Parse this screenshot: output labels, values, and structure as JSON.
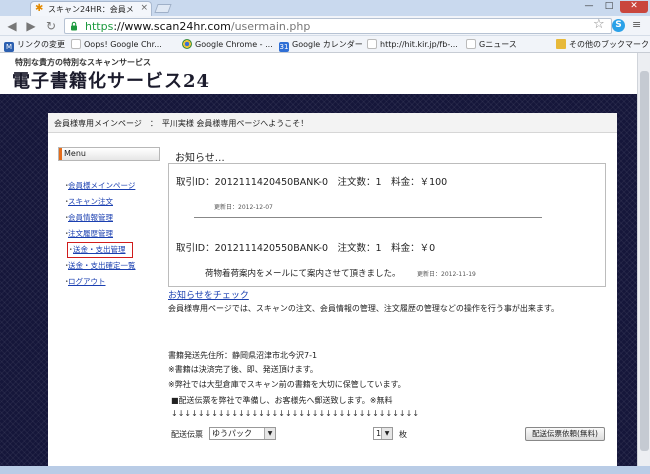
{
  "browser": {
    "tab_title": "スキャン24HR：会員メ",
    "url_secure": "https",
    "url_host": "://www.scan24hr.com",
    "url_path": "/usermain.php",
    "window_controls": {
      "minimize": "—",
      "maximize": "□",
      "close": "✕"
    },
    "bookmarks": [
      {
        "label": "リンクの変更",
        "icon": "m-icon",
        "color": "#2b5fb0"
      },
      {
        "label": "Oops! Google Chr...",
        "icon": "page-icon",
        "color": "#bbbbbb"
      },
      {
        "label": "Google Chrome - ...",
        "icon": "chrome-icon",
        "color": "#3b8e3f"
      },
      {
        "label": "Google カレンダー",
        "icon": "calendar-icon",
        "color": "#2f6fd6"
      },
      {
        "label": "http://hit.kir.jp/fb-...",
        "icon": "page-icon",
        "color": "#bbbbbb"
      },
      {
        "label": "Gニュース",
        "icon": "page-icon",
        "color": "#bbbbbb"
      }
    ],
    "other_bookmarks": "その他のブックマーク"
  },
  "site": {
    "tagline": "特別な貴方の特別なスキャンサービス",
    "logo": "電子書籍化サービス24"
  },
  "panel": {
    "breadcrumb": "会員様専用メインページ　：　平川実様 会員様専用ページへようこそ！",
    "menu": {
      "title": "Menu",
      "items": [
        "会員様メインページ",
        "スキャン注文",
        "会員情報管理",
        "注文履歴管理",
        "送金・支出管理",
        "送金・支出確定一覧",
        "ログアウト"
      ]
    },
    "notice": {
      "heading": "お知らせ…",
      "orders": [
        {
          "text": "取引ID：2012111420450BANK-0　注文数：1　料金：￥100",
          "updated": "更新日：2012-12-07"
        },
        {
          "text": "取引ID：2012111420550BANK-0　注文数：1　料金：￥0",
          "updated": "更新日：2012-11-19"
        }
      ],
      "shipped_note": "荷物着荷案内をメールにて案内させて頂きました。",
      "check_link": "お知らせをチェック"
    },
    "intro": "会員様専用ページでは、スキャンの注文、会員情報の管理、注文履歴の管理などの操作を行う事が出来ます。",
    "ship_address": "書籍発送先住所：静岡県沼津市北今沢7-1",
    "note_1": "※書籍は決済完了後、即、発送頂けます。",
    "note_2": "※弊社では大型倉庫でスキャン前の書籍を大切に保管しています。",
    "note_3": "■配送伝票を弊社で準備し、お客様先へ郵送致します。※無料",
    "arrows": "↓↓↓↓↓↓↓↓↓↓↓↓↓↓↓↓↓↓↓↓↓↓↓↓↓↓↓↓↓↓↓↓↓↓↓↓↓",
    "slip_label": "配送伝票",
    "slip_value": "ゆうパック",
    "qty_value": "1",
    "qty_unit": "枚",
    "order_slip_button": "配送伝票依頼(無料)"
  }
}
